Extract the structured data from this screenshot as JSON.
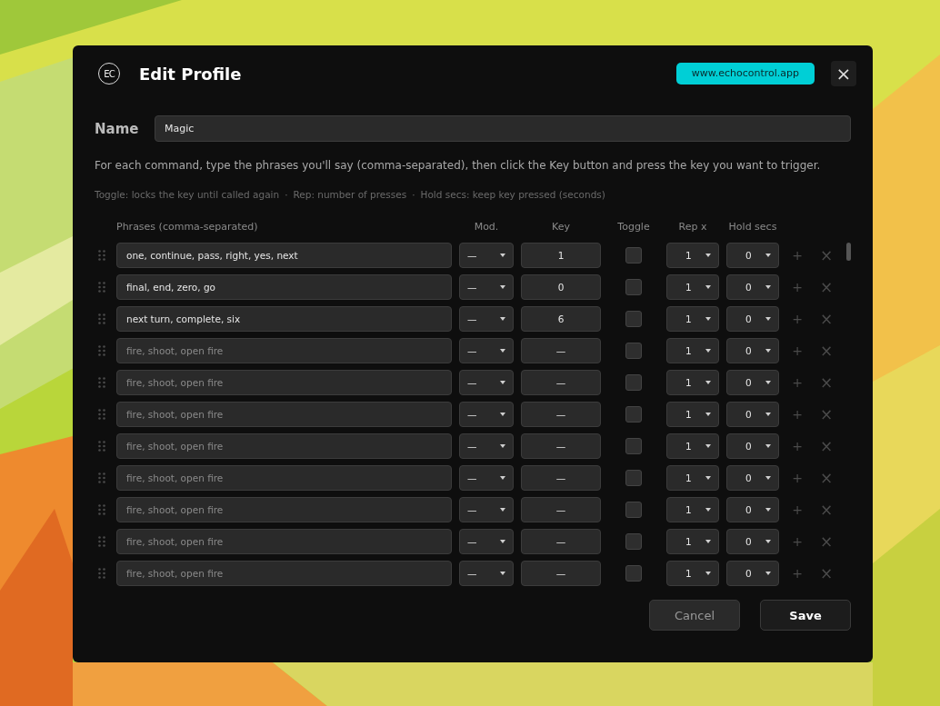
{
  "window": {
    "logo": "EC",
    "title": "Edit Profile",
    "link": "www.echocontrol.app",
    "close": "×"
  },
  "name": {
    "label": "Name",
    "value": "Magic"
  },
  "instructions": "For each command, type the phrases you'll say (comma-separated), then click the Key button and press the key you want to trigger.",
  "hints": [
    "Toggle: locks the key until called again",
    "Rep: number of presses",
    "Hold secs: keep key pressed (seconds)"
  ],
  "hint_separator": "·",
  "columns": [
    "Phrases (comma-separated)",
    "Mod.",
    "Key",
    "Toggle",
    "Rep x",
    "Hold secs"
  ],
  "rows": [
    {
      "phrases": "one, continue, pass, right, yes, next",
      "mod": "—",
      "key": "1",
      "toggle": false,
      "rep": "1",
      "hold": "0",
      "add": "+",
      "remove": "×"
    },
    {
      "phrases": "final, end, zero, go",
      "mod": "—",
      "key": "0",
      "toggle": false,
      "rep": "1",
      "hold": "0",
      "add": "+",
      "remove": "×"
    },
    {
      "phrases": "next turn, complete, six",
      "mod": "—",
      "key": "6",
      "toggle": false,
      "rep": "1",
      "hold": "0",
      "add": "+",
      "remove": "×"
    },
    {
      "placeholder": "fire, shoot, open fire",
      "mod": "—",
      "key": "—",
      "toggle": false,
      "rep": "1",
      "hold": "0",
      "add": "+",
      "remove": "×"
    },
    {
      "placeholder": "fire, shoot, open fire",
      "mod": "—",
      "key": "—",
      "toggle": false,
      "rep": "1",
      "hold": "0",
      "add": "+",
      "remove": "×"
    },
    {
      "placeholder": "fire, shoot, open fire",
      "mod": "—",
      "key": "—",
      "toggle": false,
      "rep": "1",
      "hold": "0",
      "add": "+",
      "remove": "×"
    },
    {
      "placeholder": "fire, shoot, open fire",
      "mod": "—",
      "key": "—",
      "toggle": false,
      "rep": "1",
      "hold": "0",
      "add": "+",
      "remove": "×"
    },
    {
      "placeholder": "fire, shoot, open fire",
      "mod": "—",
      "key": "—",
      "toggle": false,
      "rep": "1",
      "hold": "0",
      "add": "+",
      "remove": "×"
    },
    {
      "placeholder": "fire, shoot, open fire",
      "mod": "—",
      "key": "—",
      "toggle": false,
      "rep": "1",
      "hold": "0",
      "add": "+",
      "remove": "×"
    },
    {
      "placeholder": "fire, shoot, open fire",
      "mod": "—",
      "key": "—",
      "toggle": false,
      "rep": "1",
      "hold": "0",
      "add": "+",
      "remove": "×"
    },
    {
      "placeholder": "fire, shoot, open fire",
      "mod": "—",
      "key": "—",
      "toggle": false,
      "rep": "1",
      "hold": "0",
      "add": "+",
      "remove": "×"
    }
  ],
  "buttons": {
    "cancel": "Cancel",
    "save": "Save"
  }
}
